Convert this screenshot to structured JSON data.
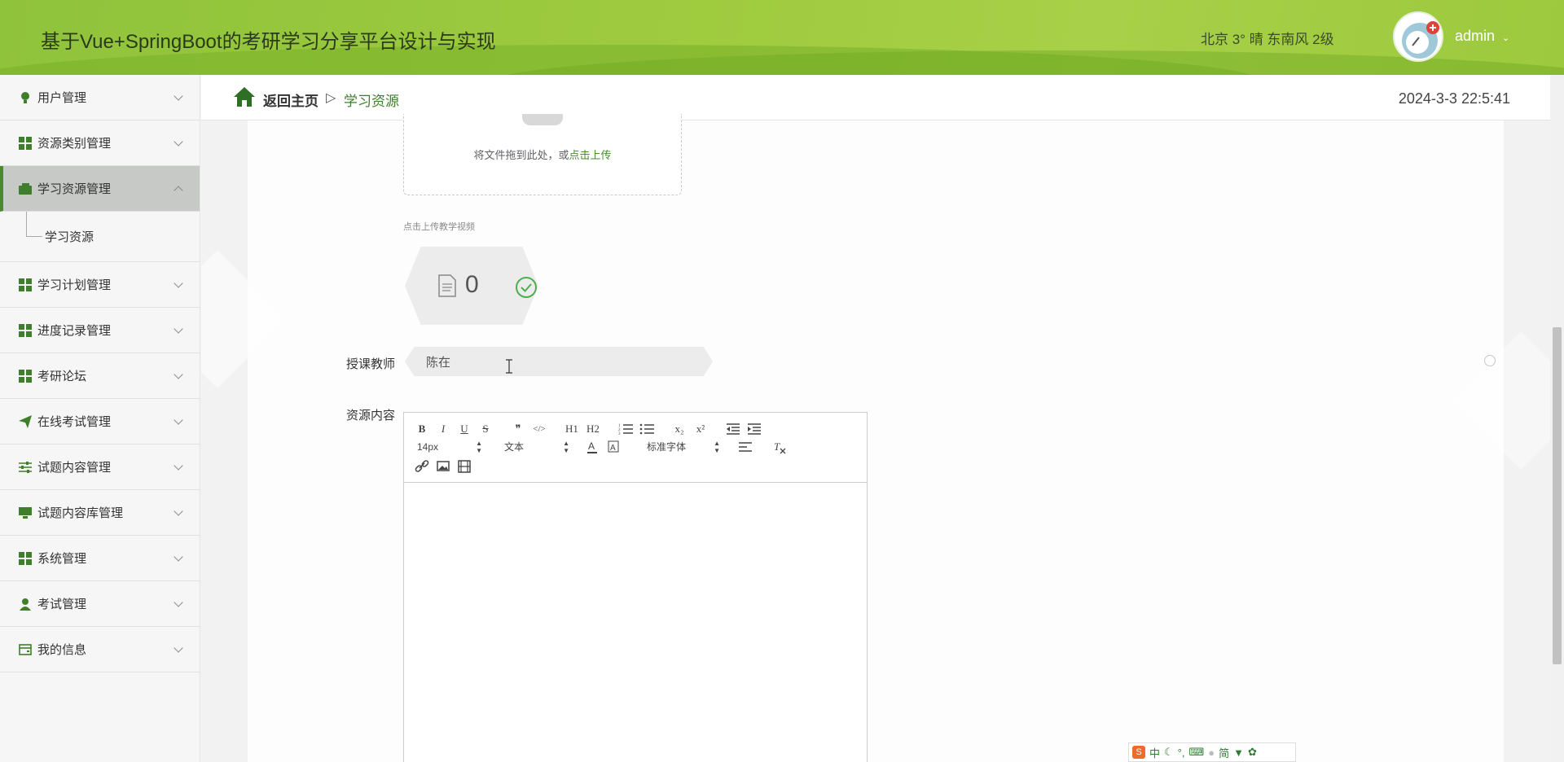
{
  "header": {
    "title": "基于Vue+SpringBoot的考研学习分享平台设计与实现",
    "weather": "北京 3° 晴 东南风 2级",
    "username": "admin"
  },
  "sidebar": {
    "items": [
      {
        "label": "用户管理",
        "icon": "bulb-icon"
      },
      {
        "label": "资源类别管理",
        "icon": "grid-icon"
      },
      {
        "label": "学习资源管理",
        "icon": "wallet-icon"
      },
      {
        "label": "学习计划管理",
        "icon": "grid-icon"
      },
      {
        "label": "进度记录管理",
        "icon": "grid-icon"
      },
      {
        "label": "考研论坛",
        "icon": "grid-icon"
      },
      {
        "label": "在线考试管理",
        "icon": "send-icon"
      },
      {
        "label": "试题内容管理",
        "icon": "sliders-icon"
      },
      {
        "label": "试题内容库管理",
        "icon": "monitor-icon"
      },
      {
        "label": "系统管理",
        "icon": "grid-icon"
      },
      {
        "label": "考试管理",
        "icon": "user-icon"
      },
      {
        "label": "我的信息",
        "icon": "card-icon"
      }
    ],
    "sub_item": "学习资源"
  },
  "breadcrumb": {
    "home": "返回主页",
    "separator": "▷",
    "current": "学习资源"
  },
  "clock": "2024-3-3 22:5:41",
  "form": {
    "upload_tip_prefix": "将文件拖到此处，或",
    "upload_tip_link": "点击上传",
    "video_hint": "点击上传教学视频",
    "file_count": "0",
    "teacher_label": "授课教师",
    "teacher_value": "陈在",
    "content_label": "资源内容"
  },
  "editor": {
    "font_size": "14px",
    "block_type": "文本",
    "font_family": "标准字体",
    "buttons": [
      "B",
      "I",
      "U",
      "S",
      "❞",
      "</>",
      "H1",
      "H2",
      "x₂",
      "x²"
    ]
  },
  "ime": {
    "lang": "中",
    "mode": "简"
  },
  "colors": {
    "accent": "#4a8a2c",
    "header": "#9fcb3f"
  }
}
